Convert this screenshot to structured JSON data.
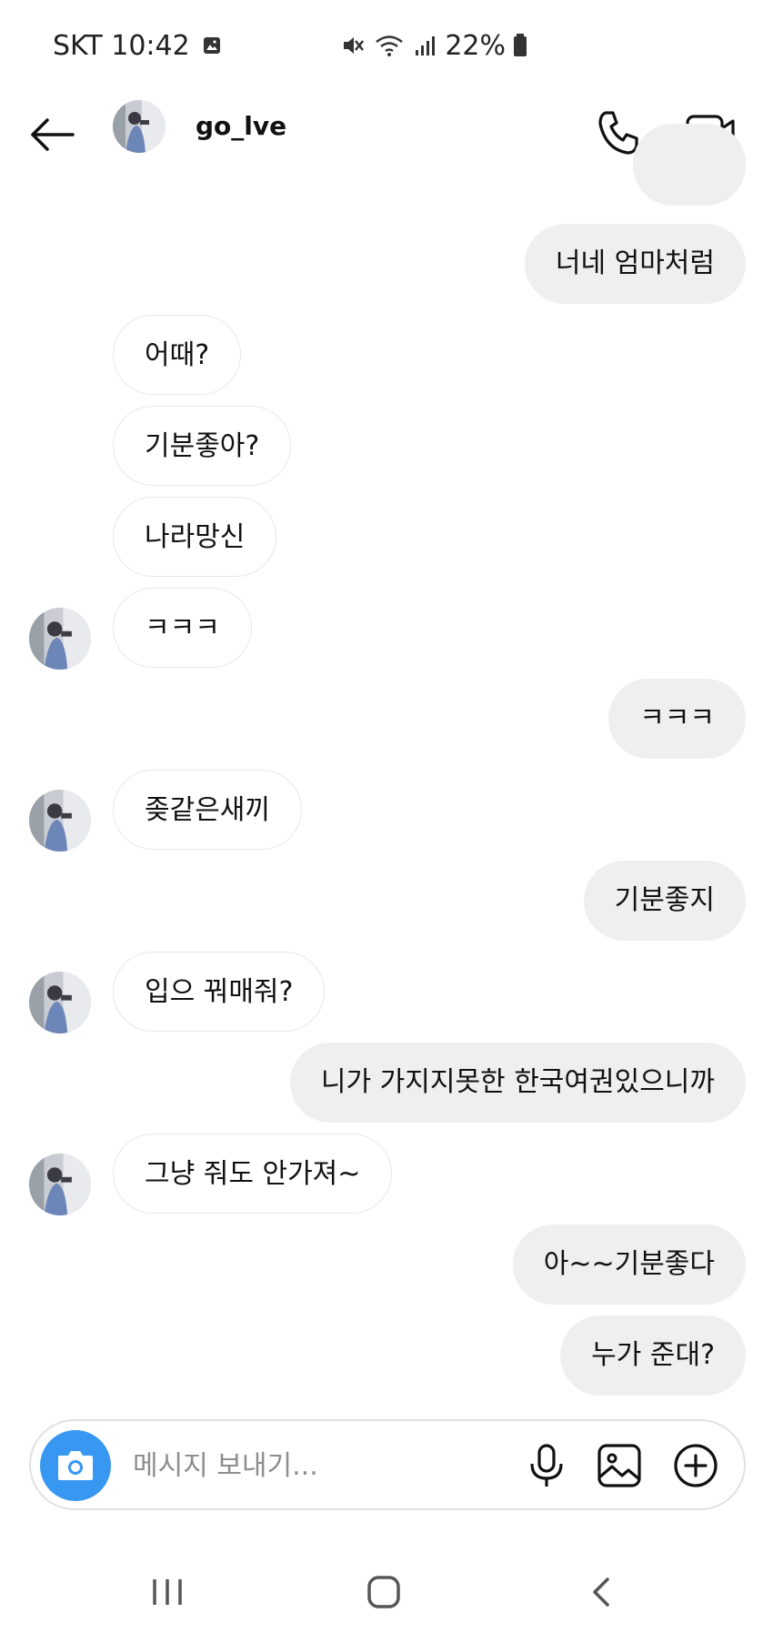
{
  "status_bar": {
    "carrier_time": "SKT 10:42",
    "battery": "22%",
    "icons": [
      "gallery-icon",
      "mute-icon",
      "wifi-icon",
      "signal-icon",
      "battery-icon"
    ]
  },
  "header": {
    "username": "go_lve",
    "icons": [
      "back-arrow-icon",
      "avatar",
      "phone-icon",
      "video-call-icon"
    ]
  },
  "messages": [
    {
      "side": "out",
      "text": ""
    },
    {
      "side": "out",
      "text": "너네 엄마처럼"
    },
    {
      "side": "in",
      "text": "어때?"
    },
    {
      "side": "in",
      "text": "기분좋아?"
    },
    {
      "side": "in",
      "text": "나라망신"
    },
    {
      "side": "in",
      "text": "ㅋㅋㅋ"
    },
    {
      "side": "out",
      "text": "ㅋㅋㅋ"
    },
    {
      "side": "in",
      "text": "좆같은새끼"
    },
    {
      "side": "out",
      "text": "기분좋지"
    },
    {
      "side": "in",
      "text": "입으 꿔매줘?"
    },
    {
      "side": "out",
      "text": "니가 가지지못한 한국여권있으니까"
    },
    {
      "side": "in",
      "text": "그냥 줘도 안가져~"
    },
    {
      "side": "out",
      "text": "아~~기분좋다"
    },
    {
      "side": "out",
      "text": "누가 준대?"
    }
  ],
  "composer": {
    "placeholder": "메시지 보내기...",
    "accent_color": "#3897f0",
    "icons": [
      "camera-icon",
      "microphone-icon",
      "image-icon",
      "plus-icon"
    ]
  },
  "nav_bar": {
    "icons": [
      "recents-icon",
      "home-icon",
      "back-icon"
    ]
  }
}
